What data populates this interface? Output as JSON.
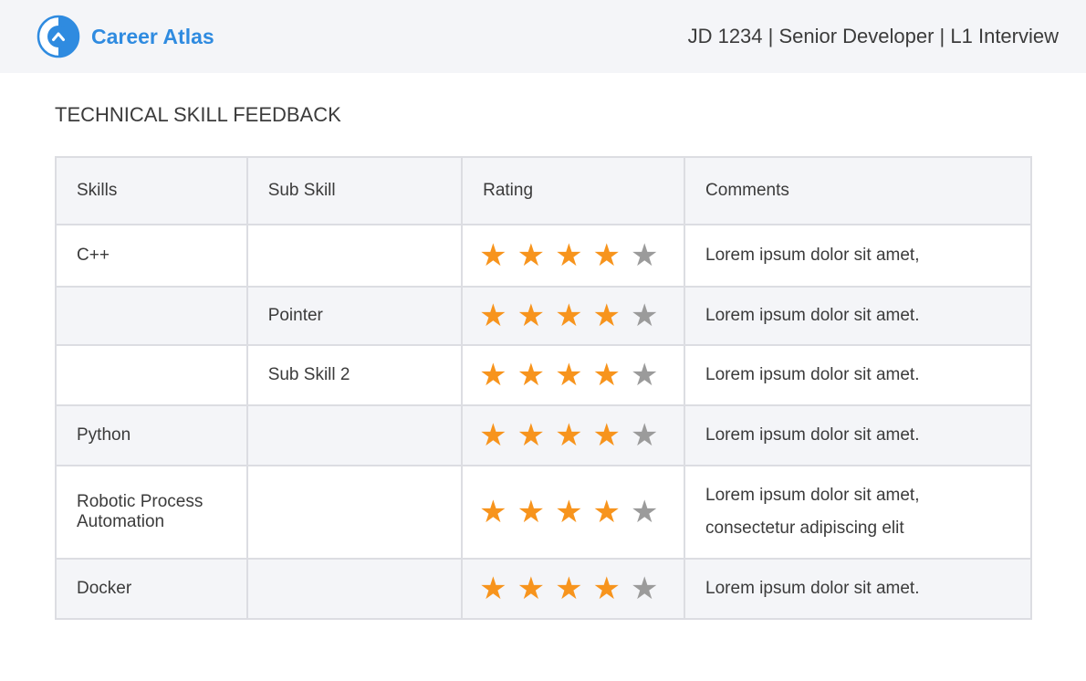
{
  "header": {
    "brand": "Career Atlas",
    "job_title": "JD 1234 | Senior Developer | L1 Interview",
    "logo_icon": "career-atlas-logo"
  },
  "section_title": "TECHNICAL SKILL FEEDBACK",
  "table": {
    "columns": [
      "Skills",
      "Sub Skill",
      "Rating",
      "Comments"
    ],
    "rows": [
      {
        "skill": "C++",
        "sub_skill": "",
        "rating": 4,
        "max": 5,
        "comment": "Lorem ipsum dolor sit amet,"
      },
      {
        "skill": "",
        "sub_skill": "Pointer",
        "rating": 4,
        "max": 5,
        "comment": "Lorem ipsum dolor sit amet."
      },
      {
        "skill": "",
        "sub_skill": "Sub Skill 2",
        "rating": 4,
        "max": 5,
        "comment": "Lorem ipsum dolor sit amet."
      },
      {
        "skill": "Python",
        "sub_skill": "",
        "rating": 4,
        "max": 5,
        "comment": "Lorem ipsum dolor sit amet."
      },
      {
        "skill": "Robotic Process Automation",
        "sub_skill": "",
        "rating": 4,
        "max": 5,
        "comment": "Lorem ipsum dolor sit amet, consectetur adipiscing elit"
      },
      {
        "skill": "Docker",
        "sub_skill": "",
        "rating": 4,
        "max": 5,
        "comment": "Lorem ipsum dolor sit amet."
      }
    ]
  },
  "colors": {
    "brand": "#2f8be0",
    "star_filled": "#f7941d",
    "star_empty": "#9b9b9b",
    "header_bg": "#f4f5f8"
  }
}
